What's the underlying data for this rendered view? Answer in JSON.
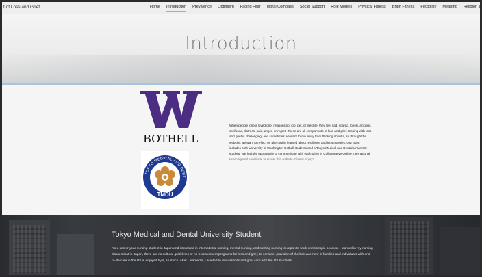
{
  "header": {
    "site_title": "t of Loss and Grief",
    "menu": [
      {
        "label": "Home",
        "active": false
      },
      {
        "label": "Introduction",
        "active": true
      },
      {
        "label": "Prevalence",
        "active": false
      },
      {
        "label": "Optimism",
        "active": false
      },
      {
        "label": "Facing Fear",
        "active": false
      },
      {
        "label": "Moral Compass",
        "active": false
      },
      {
        "label": "Social Support",
        "active": false
      },
      {
        "label": "Role Models",
        "active": false
      },
      {
        "label": "Physical Fitness",
        "active": false
      },
      {
        "label": "Brain Fitness",
        "active": false
      },
      {
        "label": "Flexibility",
        "active": false
      },
      {
        "label": "Meaning",
        "active": false
      },
      {
        "label": "Religion & Spiritual",
        "active": false
      }
    ],
    "accent_color": "#9bb1c6"
  },
  "hero": {
    "title": "Introduction"
  },
  "intro": {
    "logo_letter": "W",
    "logo_caption": "BOTHELL",
    "logo_color": "#4b2e83",
    "seal_text": "TOKYO MEDICAL AND DENTAL UNIVERSITY",
    "seal_abbrev": "TMDU",
    "paragraph": "When people lose a loved one, relationship, job, pet, or lifestyle, they feel sad, scared, lonely, anxious, confused, distress, pain, anger, or regret. These are all components of loss and grief. Coping with loss and grief is challenging, and sometimes we want to run away from thinking about it, so through this website, we want to reflect on alternative learned about resilience and its strategies. Our team includes both University of Washington Bothell students and a Tokyo Medical and Dental University student. We had the opportunity to communicate with each other in Collaborative Online International",
    "paragraph_faint": "Learning and contribute to create this website. Please enjoy!"
  },
  "lower": {
    "heading": "Tokyo Medical and Dental University Student",
    "body": "I'm a senior year nursing student in Japan and interested in international nursing, mental nursing, and starting nursing in Japan to work on this topic because I learned in my nursing classes that in Japan, there are no cultural guidelines or no bereavement programs for loss and grief, to consider provision of the bereavement of families and individuals with end-of-life care in the US is enjoyed by it, so much. After I learned it, I wanted to discuss loss and grief care with the US students."
  }
}
